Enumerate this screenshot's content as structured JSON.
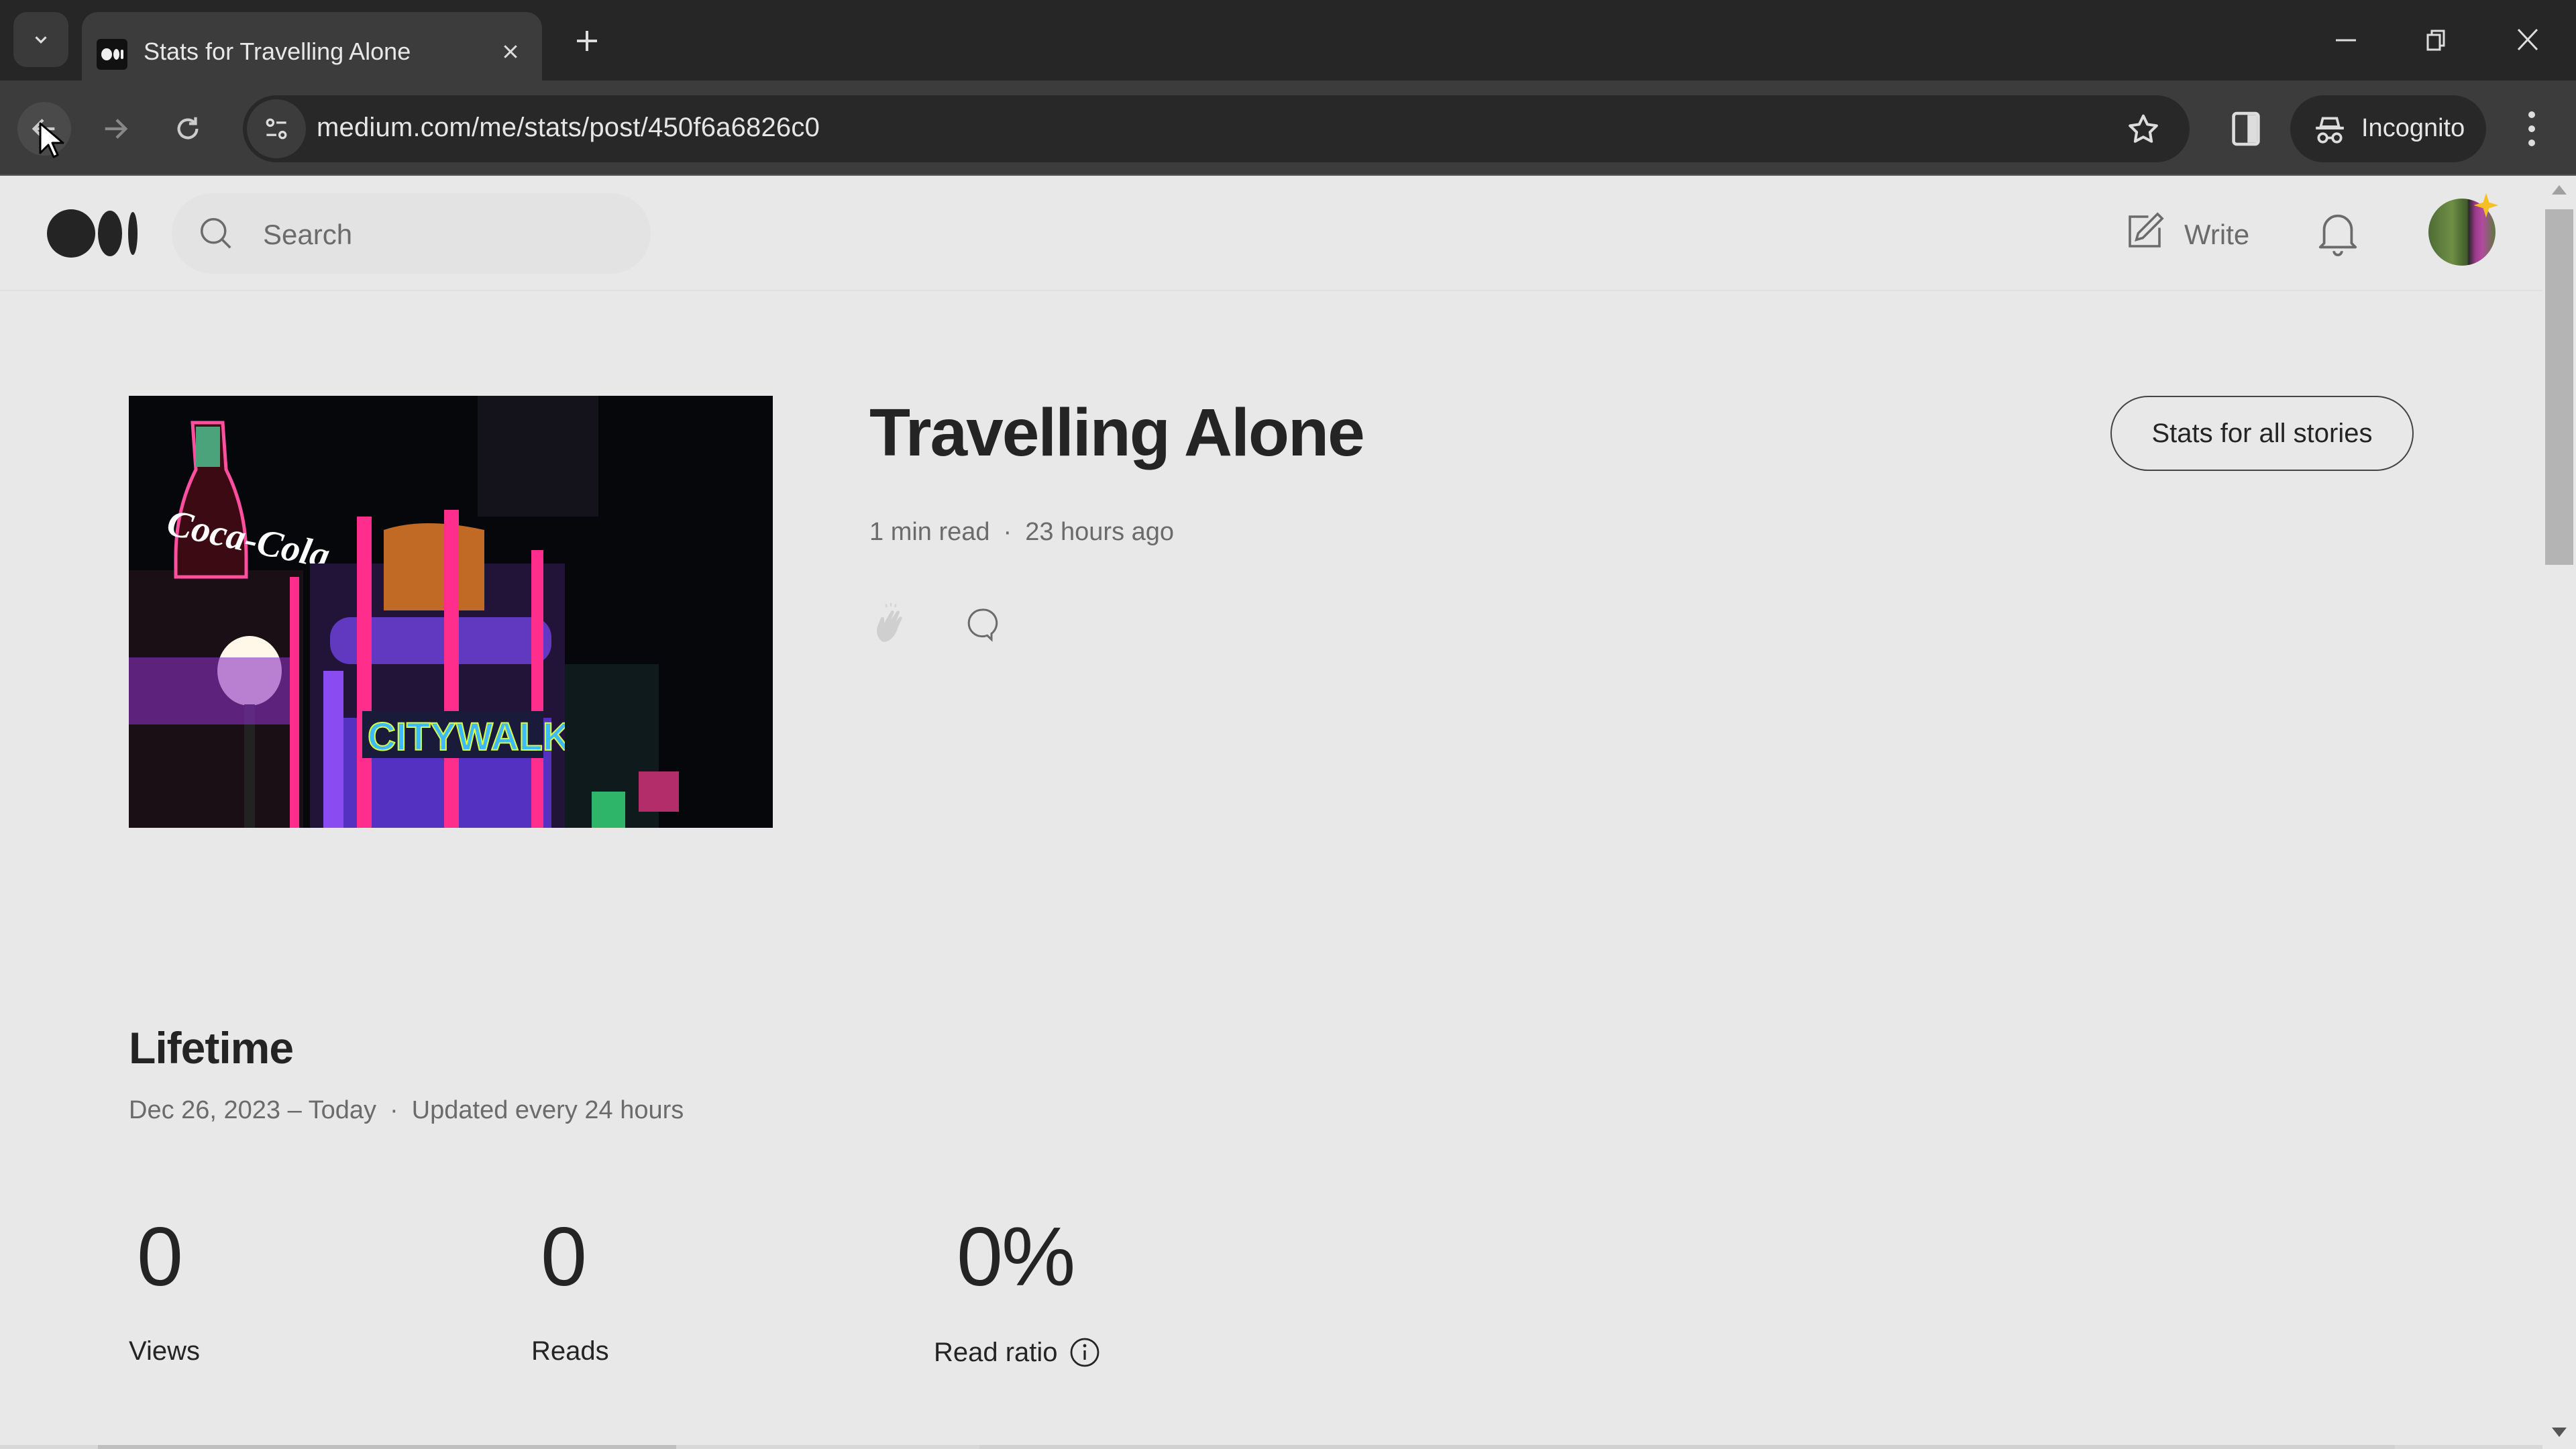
{
  "browser": {
    "tab_title": "Stats for Travelling Alone",
    "url": "medium.com/me/stats/post/450f6a6826c0",
    "incognito_label": "Incognito",
    "icons": {
      "tab_search": "chevron-down-icon",
      "tab_close": "close-icon",
      "new_tab": "plus-icon",
      "minimize": "minimize-icon",
      "restore": "restore-icon",
      "close_window": "close-icon",
      "back": "arrow-left-icon",
      "forward": "arrow-right-icon",
      "reload": "reload-icon",
      "site_info": "tune-icon",
      "bookmark": "star-icon",
      "side_panel": "side-panel-icon",
      "incognito": "incognito-icon",
      "menu": "more-vert-icon"
    },
    "tab_close_glyph": "✕",
    "new_tab_glyph": "+"
  },
  "header": {
    "search_placeholder": "Search",
    "write_label": "Write"
  },
  "story": {
    "title": "Travelling Alone",
    "read_time": "1 min read",
    "published": "23 hours ago",
    "separator": "·",
    "thumbnail_alt": "Neon-lit CityWalk building at night with Coca-Cola sign",
    "thumbnail_text": {
      "sign1": "Coca-Cola",
      "sign2": "CITYWALK"
    }
  },
  "actions": {
    "all_stats_label": "Stats for all stories"
  },
  "lifetime": {
    "title": "Lifetime",
    "range": "Dec 26, 2023 – Today",
    "separator": "·",
    "update_note": "Updated every 24 hours"
  },
  "stats": {
    "views": {
      "value": "0",
      "label": "Views"
    },
    "reads": {
      "value": "0",
      "label": "Reads"
    },
    "read_ratio": {
      "value": "0%",
      "label": "Read ratio"
    }
  },
  "colors": {
    "page_bg": "#e8e8e8",
    "text_primary": "#242424",
    "text_secondary": "#6b6b6b",
    "chrome_dark": "#262626",
    "chrome_toolbar": "#3c3c3c",
    "avatar_badge": "#f5c024"
  }
}
